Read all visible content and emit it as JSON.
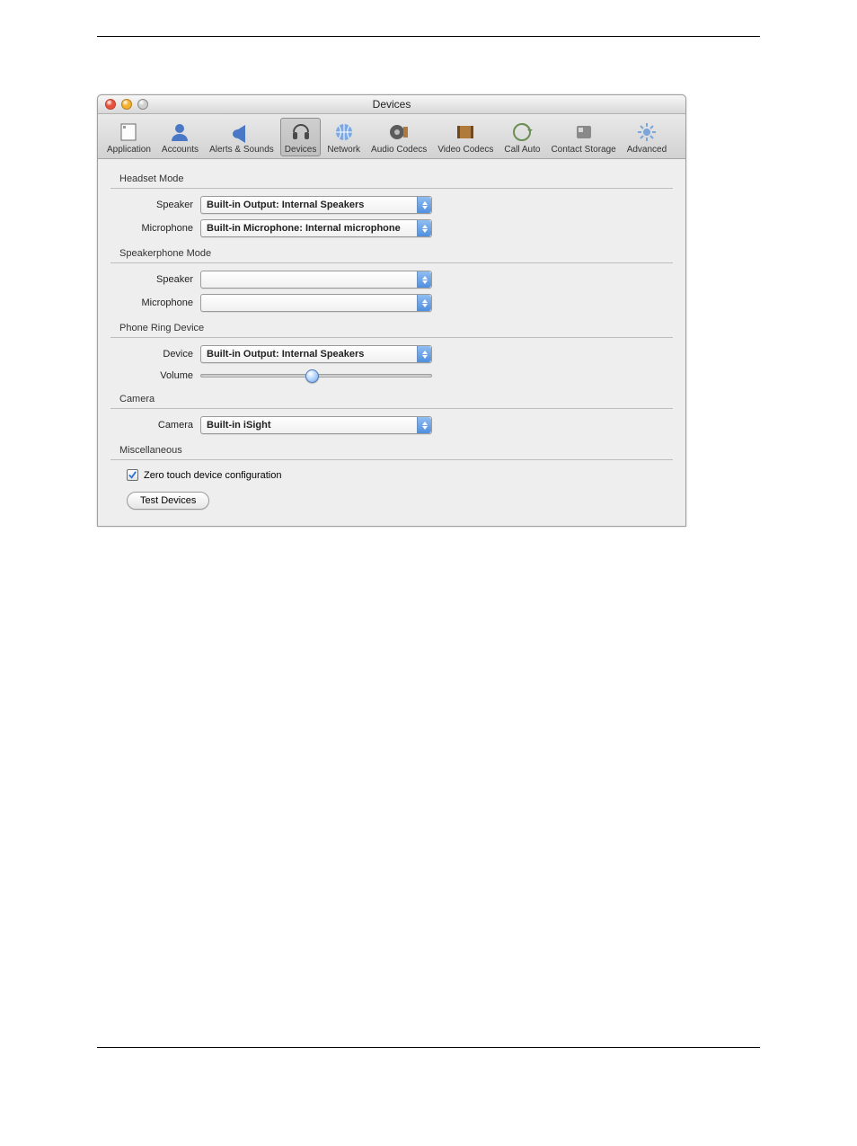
{
  "window": {
    "title": "Devices"
  },
  "toolbar": {
    "items": [
      {
        "label": "Application"
      },
      {
        "label": "Accounts"
      },
      {
        "label": "Alerts & Sounds"
      },
      {
        "label": "Devices",
        "selected": true
      },
      {
        "label": "Network"
      },
      {
        "label": "Audio Codecs"
      },
      {
        "label": "Video Codecs"
      },
      {
        "label": "Call Auto"
      },
      {
        "label": "Contact Storage"
      },
      {
        "label": "Advanced"
      }
    ]
  },
  "sections": {
    "headset": {
      "title": "Headset Mode",
      "speaker_label": "Speaker",
      "speaker_value": "Built-in Output: Internal Speakers",
      "mic_label": "Microphone",
      "mic_value": "Built-in Microphone: Internal microphone"
    },
    "speakerphone": {
      "title": "Speakerphone Mode",
      "speaker_label": "Speaker",
      "speaker_value": "",
      "mic_label": "Microphone",
      "mic_value": ""
    },
    "ring": {
      "title": "Phone Ring Device",
      "device_label": "Device",
      "device_value": "Built-in Output: Internal Speakers",
      "volume_label": "Volume",
      "volume_percent": 48
    },
    "camera": {
      "title": "Camera",
      "camera_label": "Camera",
      "camera_value": "Built-in iSight"
    },
    "misc": {
      "title": "Miscellaneous",
      "zero_touch_label": "Zero touch device configuration",
      "zero_touch_checked": true,
      "test_devices_label": "Test Devices"
    }
  }
}
